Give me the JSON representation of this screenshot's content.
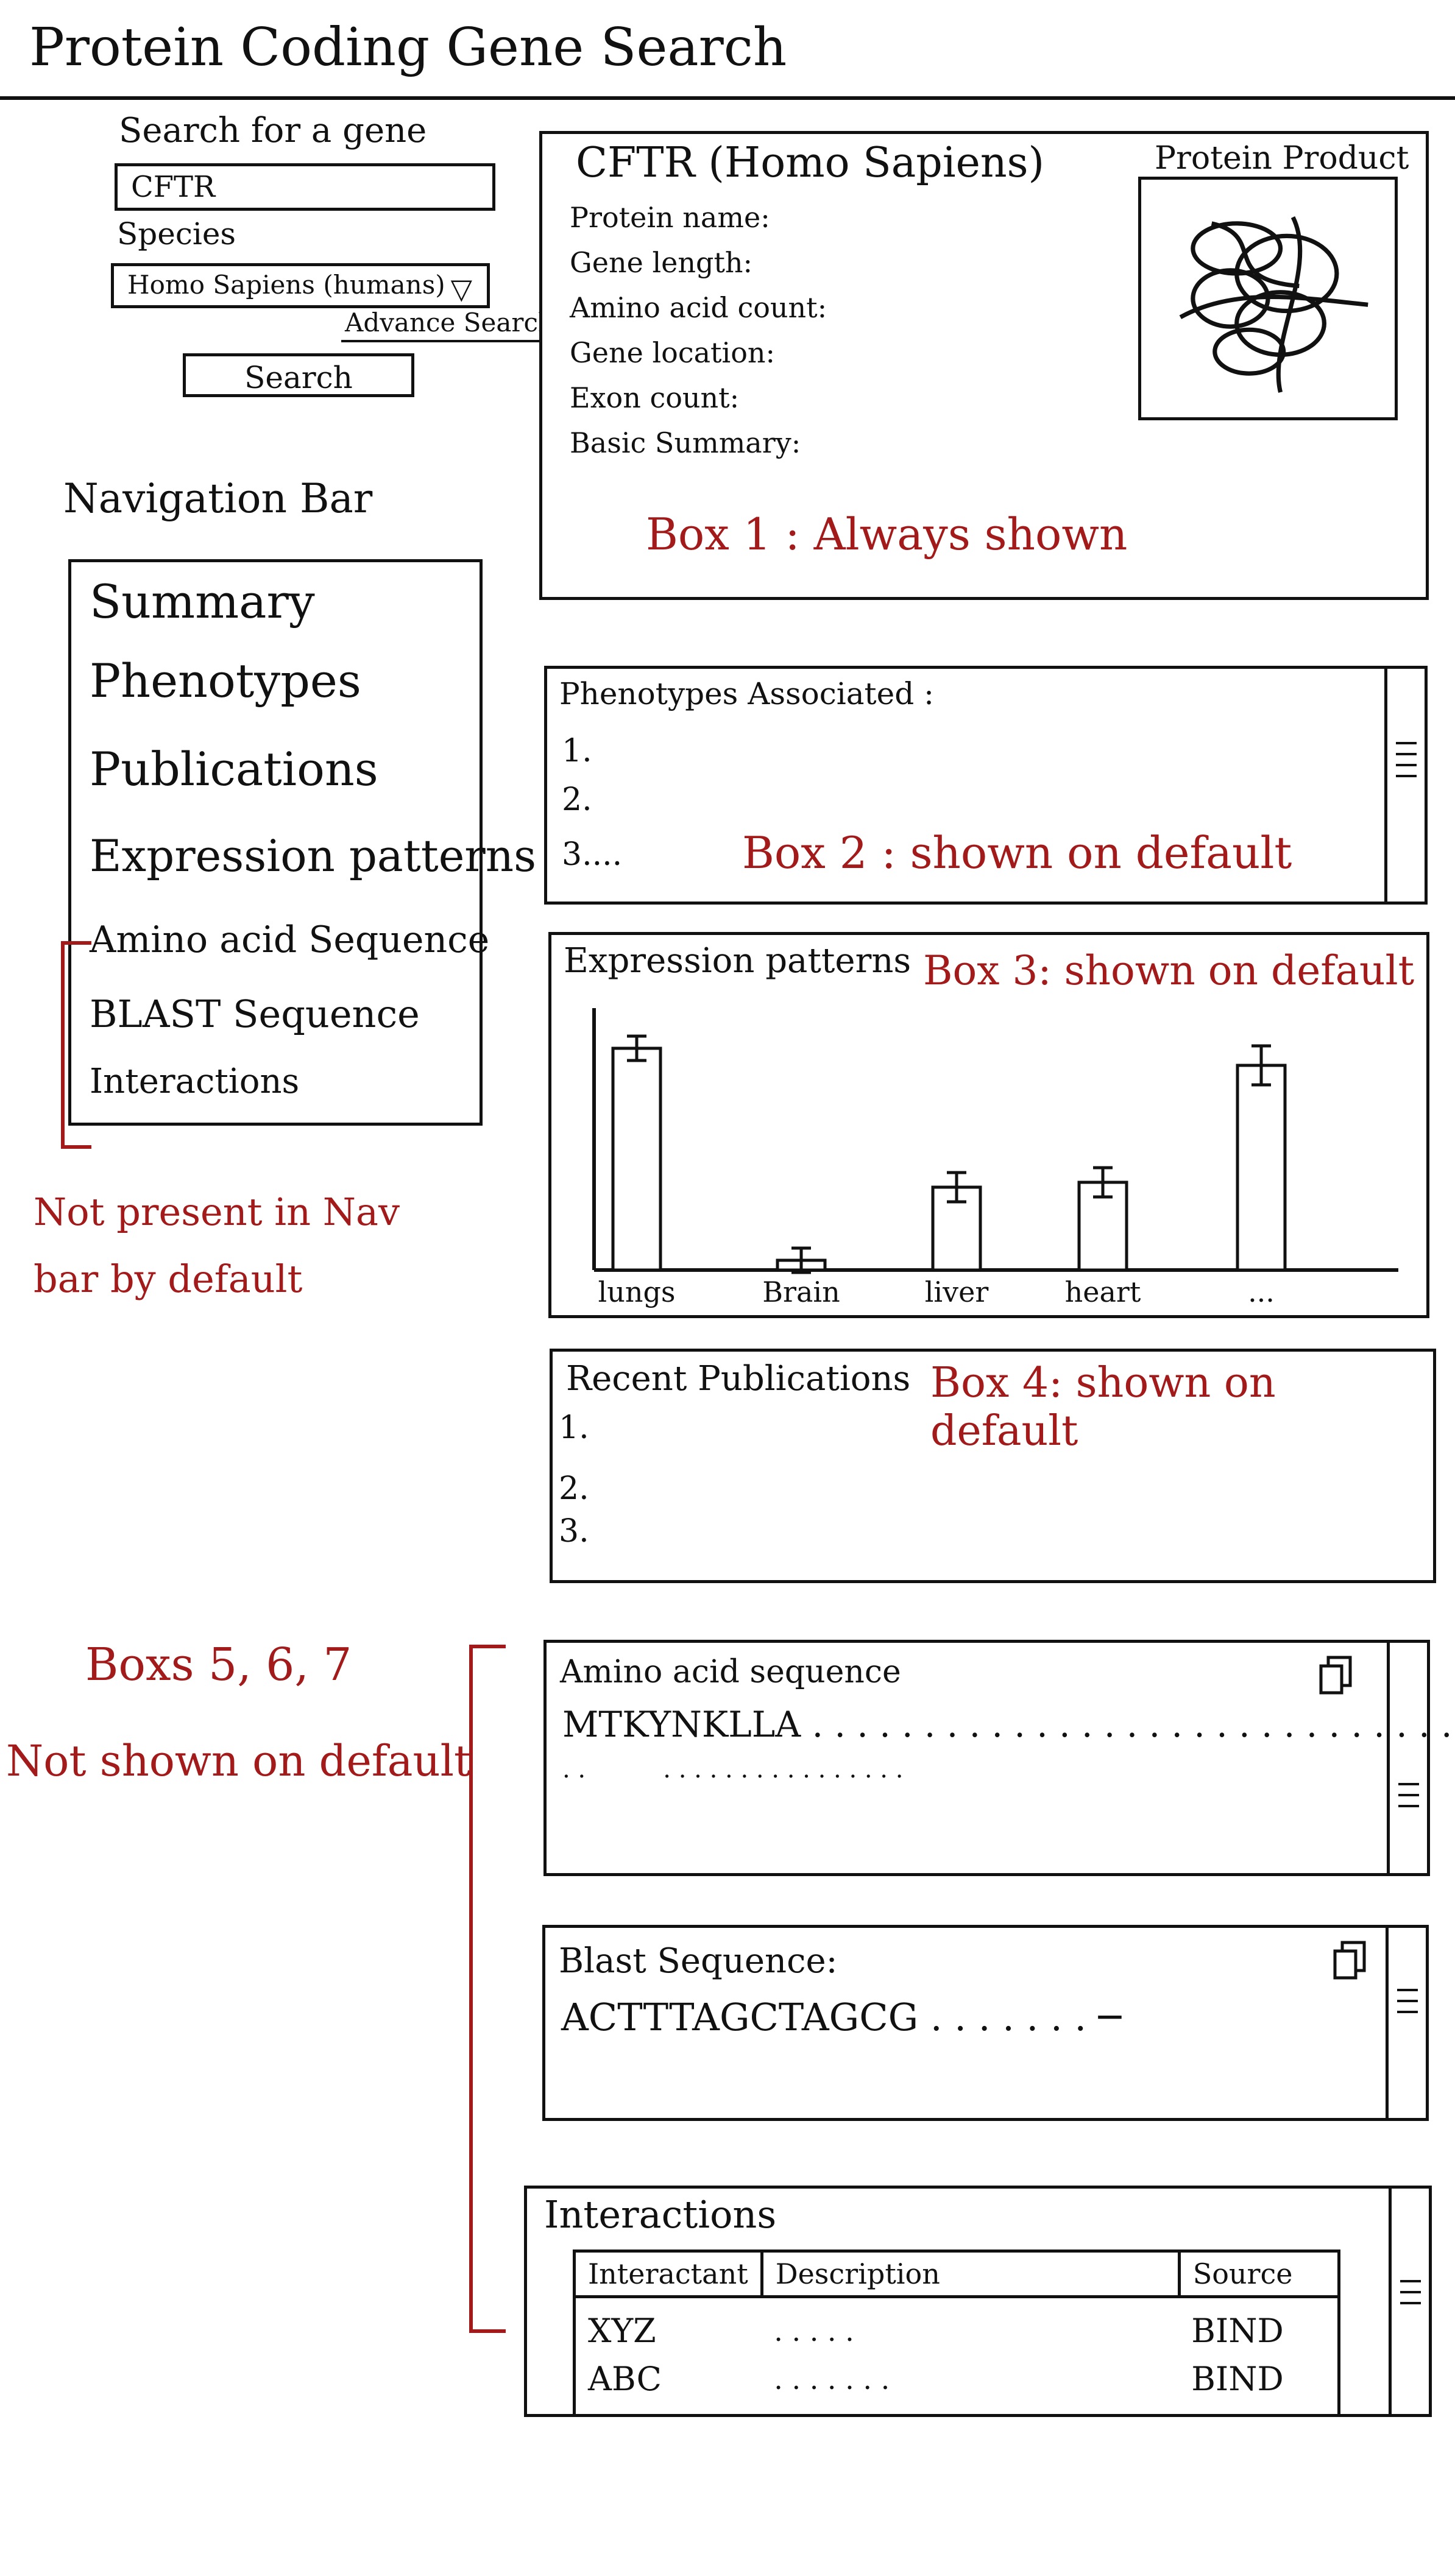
{
  "page": {
    "title": "Protein Coding Gene Search"
  },
  "search": {
    "label": "Search for a gene",
    "value": "CFTR",
    "species_label": "Species",
    "species_value": "Homo Sapiens (humans)",
    "advanced_link": "Advance Search",
    "button": "Search"
  },
  "nav": {
    "title": "Navigation Bar",
    "items": [
      "Summary",
      "Phenotypes",
      "Publications",
      "Expression patterns",
      "Amino acid Sequence",
      "BLAST Sequence",
      "Interactions"
    ],
    "note": "Not present in Nav bar by default"
  },
  "box1": {
    "header": "CFTR (Homo Sapiens)",
    "fields": [
      "Protein name:",
      "Gene length:",
      "Amino acid count:",
      "Gene location:",
      "Exon count:",
      "Basic Summary:"
    ],
    "image_label": "Protein Product",
    "annotation": "Box 1 : Always shown"
  },
  "box2": {
    "title": "Phenotypes Associated :",
    "items": [
      "1.",
      "2.",
      "3...."
    ],
    "annotation": "Box 2 : shown on default"
  },
  "box3": {
    "title": "Expression patterns",
    "annotation": "Box 3: shown on default"
  },
  "box4": {
    "title": "Recent Publications",
    "items": [
      "1.",
      "2.",
      "3."
    ],
    "annotation": "Box 4: shown on default"
  },
  "hidden_note": {
    "line1": "Boxs 5, 6, 7",
    "line2": "Not shown on default"
  },
  "box5": {
    "title": "Amino acid sequence",
    "sequence": "MTKYNKLLA . . . . . . . . . . . . . . . . . . . . . . . . . . . . . .",
    "sequence2": ". .          . . . . . . . . . . . . . . . ."
  },
  "box6": {
    "title": "Blast Sequence:",
    "sequence": "ACTTTAGCTAGCG . . . . . . .  ─"
  },
  "box7": {
    "title": "Interactions",
    "columns": [
      "Interactant",
      "Description",
      "Source"
    ],
    "rows": [
      [
        "XYZ",
        ". . . . .",
        "BIND"
      ],
      [
        "ABC",
        ". . . . . . .",
        "BIND"
      ]
    ]
  },
  "colors": {
    "ink": "#111111",
    "annotation": "#a31a1a"
  },
  "icons": [
    "dropdown-arrow-icon",
    "copy-icon",
    "scrollbar-grip-icon",
    "protein-scribble-icon"
  ],
  "chart_data": {
    "type": "bar",
    "categories": [
      "lungs",
      "Brain",
      "liver",
      "heart",
      "..."
    ],
    "values": [
      0.91,
      0.04,
      0.34,
      0.36,
      0.84
    ],
    "errors": [
      0.05,
      0.05,
      0.06,
      0.06,
      0.08
    ],
    "ylim": [
      0,
      1
    ],
    "title": "Expression patterns",
    "xlabel": "",
    "ylabel": ""
  }
}
